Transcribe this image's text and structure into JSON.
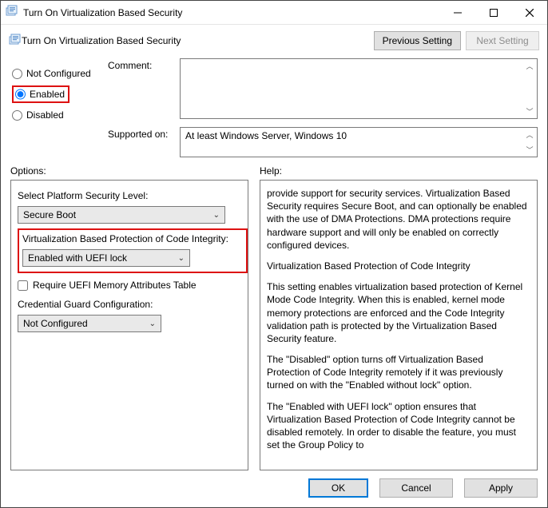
{
  "window": {
    "title": "Turn On Virtualization Based Security"
  },
  "header": {
    "title": "Turn On Virtualization Based Security",
    "prev_label": "Previous Setting",
    "next_label": "Next Setting"
  },
  "state": {
    "not_configured": "Not Configured",
    "enabled": "Enabled",
    "disabled": "Disabled",
    "selected": "enabled"
  },
  "fields": {
    "comment_label": "Comment:",
    "comment_value": "",
    "supported_label": "Supported on:",
    "supported_value": "At least Windows Server, Windows 10"
  },
  "labels": {
    "options": "Options:",
    "help": "Help:"
  },
  "options": {
    "platform_label": "Select Platform Security Level:",
    "platform_value": "Secure Boot",
    "vbpci_label": "Virtualization Based Protection of Code Integrity:",
    "vbpci_value": "Enabled with UEFI lock",
    "require_uefi_label": "Require UEFI Memory Attributes Table",
    "require_uefi_checked": false,
    "credguard_label": "Credential Guard Configuration:",
    "credguard_value": "Not Configured"
  },
  "help": {
    "p1": "provide support for security services. Virtualization Based Security requires Secure Boot, and can optionally be enabled with the use of DMA Protections. DMA protections require hardware support and will only be enabled on correctly configured devices.",
    "h1": "Virtualization Based Protection of Code Integrity",
    "p2": "This setting enables virtualization based protection of Kernel Mode Code Integrity. When this is enabled, kernel mode memory protections are enforced and the Code Integrity validation path is protected by the Virtualization Based Security feature.",
    "p3": "The \"Disabled\" option turns off Virtualization Based Protection of Code Integrity remotely if it was previously turned on with the \"Enabled without lock\" option.",
    "p4": "The \"Enabled with UEFI lock\" option ensures that Virtualization Based Protection of Code Integrity cannot be disabled remotely. In order to disable the feature, you must set the Group Policy to"
  },
  "footer": {
    "ok": "OK",
    "cancel": "Cancel",
    "apply": "Apply"
  }
}
